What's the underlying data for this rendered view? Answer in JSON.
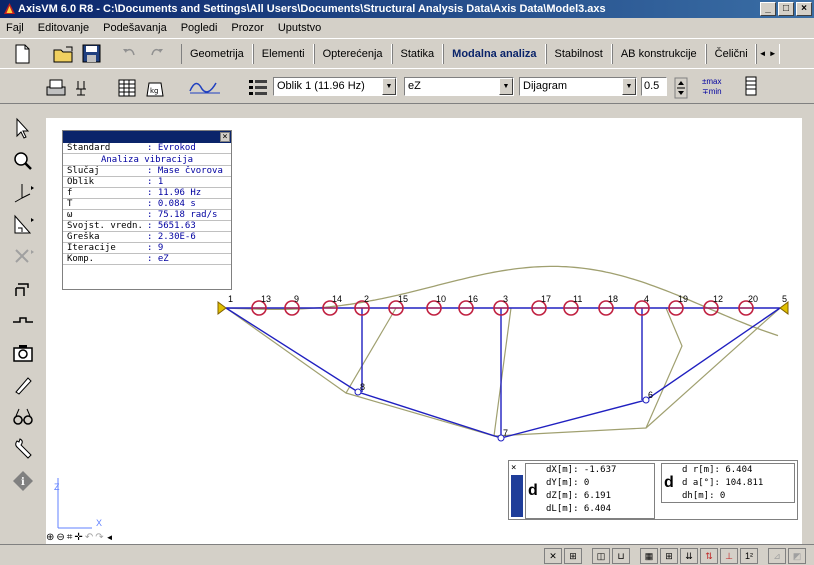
{
  "window": {
    "title": "AxisVM 6.0 R8 - C:\\Documents and Settings\\All Users\\Documents\\Structural Analysis Data\\Axis Data\\Model3.axs",
    "minimize_label": "_",
    "restore_label": "□",
    "close_label": "×"
  },
  "menu": {
    "items": [
      "Fajl",
      "Editovanje",
      "Podešavanja",
      "Pogledi",
      "Prozor",
      "Uputstvo"
    ]
  },
  "tabs": [
    "Geometrija",
    "Elementi",
    "Opterećenja",
    "Statika",
    "Modalna analiza",
    "Stabilnost",
    "AB konstrukcije",
    "Čelični"
  ],
  "active_tab": "Modalna analiza",
  "toolbar2": {
    "mode_combo": "Oblik 1  (11.96 Hz)",
    "component_combo": "eZ",
    "display_combo": "Dijagram",
    "scale_value": "0.5",
    "max_label": "max",
    "min_label": "min"
  },
  "info_panel": {
    "title": "Analiza vibracija",
    "rows": [
      {
        "key": "Standard",
        "value": ": Evrokod"
      },
      {
        "key": "Slučaj",
        "value": ": Mase čvorova"
      },
      {
        "key": "Oblik",
        "value": ": 1"
      },
      {
        "key": "f",
        "value": ": 11.96 Hz"
      },
      {
        "key": "T",
        "value": ": 0.084 s"
      },
      {
        "key": "ω",
        "value": ": 75.18 rad/s"
      },
      {
        "key": "Svojst. vredn.",
        "value": ": 5651.63"
      },
      {
        "key": "Greška",
        "value": ": 2.30E-6"
      },
      {
        "key": "Iteracije",
        "value": ": 9"
      },
      {
        "key": "Komp.",
        "value": ": eZ"
      }
    ],
    "close_label": "×"
  },
  "result_box": {
    "close_label": "×",
    "d_symbol": "d",
    "left_lines": [
      "dX[m]: -1.637",
      "dY[m]: 0",
      "dZ[m]: 6.191",
      "dL[m]: 6.404"
    ],
    "right_lines": [
      "d r[m]: 6.404",
      "d a[°]: 104.811",
      "dh[m]: 0"
    ]
  },
  "node_labels": {
    "top": [
      "1",
      "13",
      "9",
      "14",
      "2",
      "15",
      "10",
      "16",
      "3",
      "17",
      "11",
      "18",
      "4",
      "19",
      "12",
      "20",
      "5"
    ],
    "bottom": [
      "8",
      "7",
      "6"
    ]
  },
  "axes": {
    "z_label": "Z",
    "x_label": "X"
  },
  "statusbar": {
    "superscript_label": "1²"
  },
  "colors": {
    "structure": "#2020c0",
    "deformed": "#a0a070",
    "mass_circle": "#c02040",
    "support": "#e0c000",
    "titlebar": "#0a246a"
  }
}
